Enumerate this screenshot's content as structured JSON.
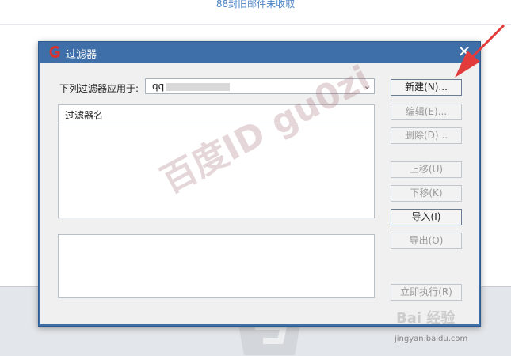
{
  "background": {
    "status_text": "88封旧邮件未收取"
  },
  "dialog": {
    "title": "过滤器",
    "close_glyph": "✕",
    "apply_label": "下列过滤器应用于:",
    "account_value": "qq",
    "list_header": "过滤器名",
    "buttons": {
      "new": "新建(N)...",
      "edit": "编辑(E)...",
      "delete": "删除(D)...",
      "move_up": "上移(U)",
      "move_down": "下移(K)",
      "import": "导入(I)",
      "export": "导出(O)",
      "run_now": "立即执行(R)"
    }
  },
  "watermark": {
    "text": "百度ID gu0zi",
    "baidu_text": "Bai 经验",
    "baidu_url": "jingyan.baidu.com"
  },
  "colors": {
    "title_bar": "#3e6fa8",
    "arrow": "#e23b3b",
    "icon_red": "#d7322f"
  }
}
